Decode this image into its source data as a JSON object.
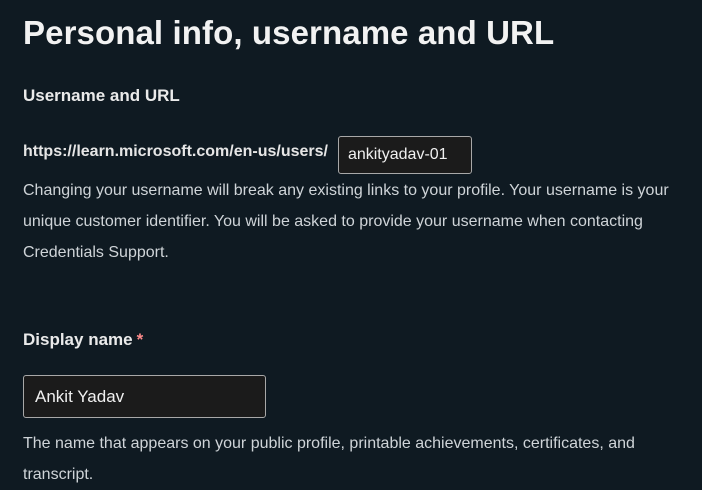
{
  "page": {
    "title": "Personal info, username and URL"
  },
  "username_section": {
    "heading": "Username and URL",
    "url_prefix": "https://learn.microsoft.com/en-us/users/",
    "username_value": "ankityadav-01",
    "help_text": "Changing your username will break any existing links to your profile. Your username is your unique customer identifier. You will be asked to provide your username when contacting Credentials Support."
  },
  "display_name_section": {
    "label": "Display name",
    "required_marker": "*",
    "value": "Ankit Yadav",
    "help_text": "The name that appears on your public profile, printable achievements, certificates, and transcript."
  },
  "colors": {
    "background": "#0f1a22",
    "input_background": "#1b1b1b",
    "input_border": "#a8a8a8",
    "required_marker": "#ff8c8c"
  }
}
